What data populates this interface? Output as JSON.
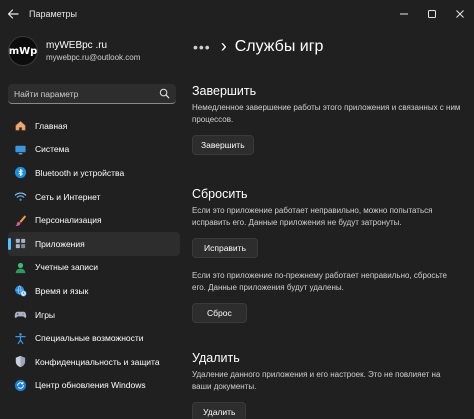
{
  "window": {
    "title": "Параметры"
  },
  "profile": {
    "avatar_text": "mWp",
    "name": "myWEBpc .ru",
    "email": "mywebpc.ru@outlook.com"
  },
  "search": {
    "placeholder": "Найти параметр"
  },
  "sidebar": {
    "items": [
      {
        "label": "Главная",
        "icon": "home-icon"
      },
      {
        "label": "Система",
        "icon": "monitor-icon"
      },
      {
        "label": "Bluetooth и устройства",
        "icon": "bluetooth-icon"
      },
      {
        "label": "Сеть и Интернет",
        "icon": "wifi-icon"
      },
      {
        "label": "Персонализация",
        "icon": "brush-icon"
      },
      {
        "label": "Приложения",
        "icon": "apps-icon",
        "selected": true
      },
      {
        "label": "Учетные записи",
        "icon": "user-icon"
      },
      {
        "label": "Время и язык",
        "icon": "globe-clock-icon"
      },
      {
        "label": "Игры",
        "icon": "gamepad-icon"
      },
      {
        "label": "Специальные возможности",
        "icon": "accessibility-icon"
      },
      {
        "label": "Конфиденциальность и защита",
        "icon": "shield-icon"
      },
      {
        "label": "Центр обновления Windows",
        "icon": "update-icon"
      }
    ]
  },
  "main": {
    "breadcrumb_more": "•••",
    "breadcrumb_sep": "›",
    "title": "Службы игр",
    "sections": {
      "terminate": {
        "title": "Завершить",
        "description": "Немедленное завершение работы этого приложения и связанных с ним процессов.",
        "button": "Завершить"
      },
      "reset": {
        "title": "Сбросить",
        "repair_description": "Если это приложение работает неправильно, можно попытаться исправить его. Данные приложения не будут затронуты.",
        "repair_button": "Исправить",
        "reset_description": "Если это приложение по-прежнему работает неправильно, сбросьте его. Данные приложения будут удалены.",
        "reset_button": "Сброс"
      },
      "uninstall": {
        "title": "Удалить",
        "description": "Удаление данного приложения и его настроек. Это не повлияет на ваши документы.",
        "button": "Удалить"
      }
    }
  },
  "colors": {
    "background": "#202020",
    "accent": "#4cc2ff",
    "button_bg": "#2d2d2d"
  }
}
